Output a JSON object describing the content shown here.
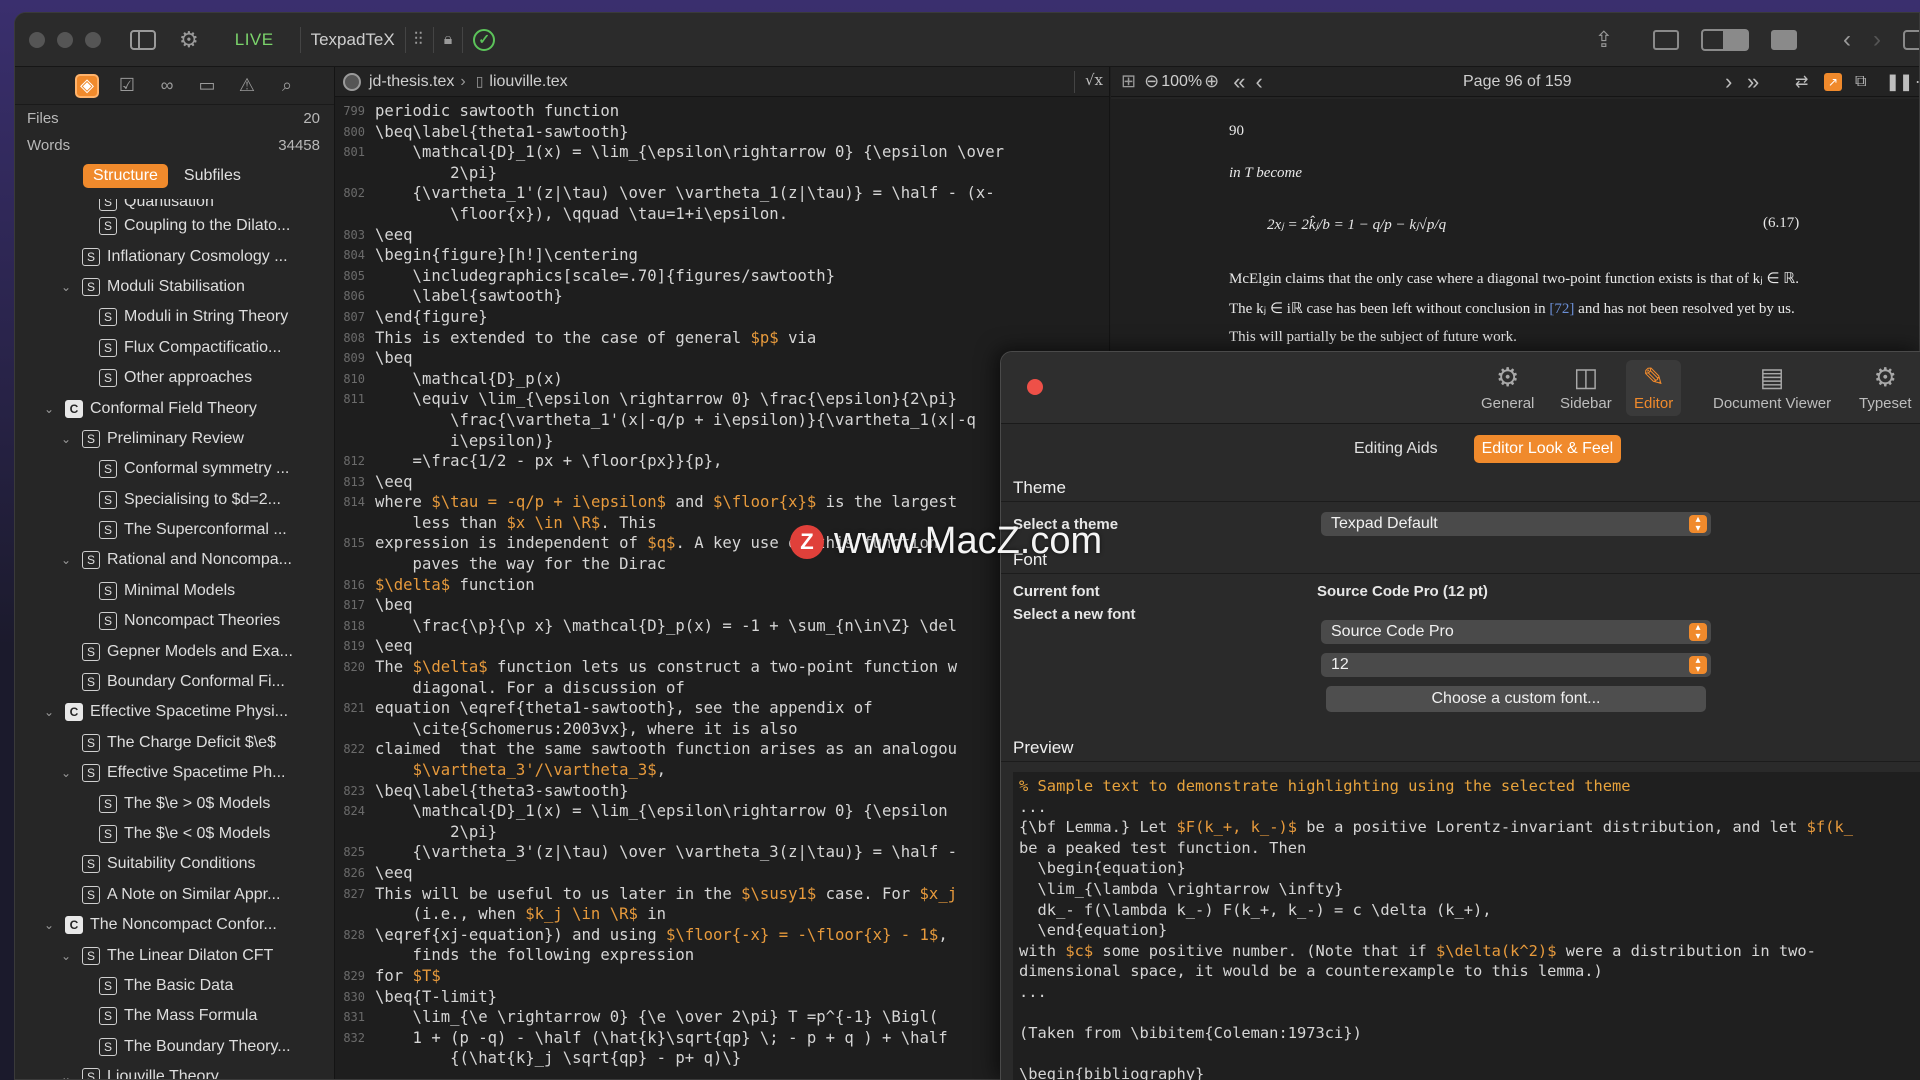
{
  "titlebar": {
    "live_label": "LIVE",
    "app_name": "TexpadTeX"
  },
  "sidebar": {
    "stats": [
      {
        "label": "Files",
        "value": "20"
      },
      {
        "label": "Words",
        "value": "34458"
      }
    ],
    "tabs": [
      "Structure",
      "Subfiles"
    ],
    "tree": [
      {
        "indent": 3,
        "badge": "S",
        "chev": "",
        "label": "Quantisation"
      },
      {
        "indent": 3,
        "badge": "S",
        "chev": "",
        "label": "Coupling to the Dilato..."
      },
      {
        "indent": 2,
        "badge": "S",
        "chev": "",
        "label": "Inflationary Cosmology ..."
      },
      {
        "indent": 2,
        "badge": "S",
        "chev": "⌄",
        "label": "Moduli Stabilisation"
      },
      {
        "indent": 3,
        "badge": "S",
        "chev": "",
        "label": "Moduli in String Theory"
      },
      {
        "indent": 3,
        "badge": "S",
        "chev": "",
        "label": "Flux Compactificatio..."
      },
      {
        "indent": 3,
        "badge": "S",
        "chev": "",
        "label": "Other approaches"
      },
      {
        "indent": 1,
        "badge": "C",
        "chev": "⌄",
        "label": "Conformal Field Theory"
      },
      {
        "indent": 2,
        "badge": "S",
        "chev": "⌄",
        "label": "Preliminary Review"
      },
      {
        "indent": 3,
        "badge": "S",
        "chev": "",
        "label": "Conformal symmetry ..."
      },
      {
        "indent": 3,
        "badge": "S",
        "chev": "",
        "label": "Specialising to $d=2..."
      },
      {
        "indent": 3,
        "badge": "S",
        "chev": "",
        "label": "The Superconformal ..."
      },
      {
        "indent": 2,
        "badge": "S",
        "chev": "⌄",
        "label": "Rational and Noncompa..."
      },
      {
        "indent": 3,
        "badge": "S",
        "chev": "",
        "label": "Minimal Models"
      },
      {
        "indent": 3,
        "badge": "S",
        "chev": "",
        "label": "Noncompact Theories"
      },
      {
        "indent": 2,
        "badge": "S",
        "chev": "",
        "label": "Gepner Models and Exa..."
      },
      {
        "indent": 2,
        "badge": "S",
        "chev": "",
        "label": "Boundary Conformal Fi..."
      },
      {
        "indent": 1,
        "badge": "C",
        "chev": "⌄",
        "label": "Effective Spacetime Physi..."
      },
      {
        "indent": 2,
        "badge": "S",
        "chev": "",
        "label": "The Charge Deficit $\\e$"
      },
      {
        "indent": 2,
        "badge": "S",
        "chev": "⌄",
        "label": "Effective Spacetime Ph..."
      },
      {
        "indent": 3,
        "badge": "S",
        "chev": "",
        "label": "The $\\e > 0$ Models"
      },
      {
        "indent": 3,
        "badge": "S",
        "chev": "",
        "label": "The $\\e < 0$ Models"
      },
      {
        "indent": 2,
        "badge": "S",
        "chev": "",
        "label": "Suitability Conditions"
      },
      {
        "indent": 2,
        "badge": "S",
        "chev": "",
        "label": "A Note on Similar Appr..."
      },
      {
        "indent": 1,
        "badge": "C",
        "chev": "⌄",
        "label": "The Noncompact Confor..."
      },
      {
        "indent": 2,
        "badge": "S",
        "chev": "⌄",
        "label": "The Linear Dilaton CFT"
      },
      {
        "indent": 3,
        "badge": "S",
        "chev": "",
        "label": "The Basic Data"
      },
      {
        "indent": 3,
        "badge": "S",
        "chev": "",
        "label": "The Mass Formula"
      },
      {
        "indent": 3,
        "badge": "S",
        "chev": "",
        "label": "The Boundary Theory..."
      },
      {
        "indent": 2,
        "badge": "S",
        "chev": "⌄",
        "label": "Liouville Theory"
      }
    ]
  },
  "editor": {
    "breadcrumb_file": "jd-thesis.tex",
    "breadcrumb_sep": "›",
    "breadcrumb_current": "liouville.tex",
    "sqrt_button": "√x",
    "lines": [
      {
        "n": "799",
        "t": "periodic sawtooth function"
      },
      {
        "n": "800",
        "t": "\\beq\\label{theta1-sawtooth}"
      },
      {
        "n": "801",
        "t": "    \\mathcal{D}_1(x) = \\lim_{\\epsilon\\rightarrow 0} {\\epsilon \\over"
      },
      {
        "n": "",
        "t": "        2\\pi}"
      },
      {
        "n": "802",
        "t": "    {\\vartheta_1'(z|\\tau) \\over \\vartheta_1(z|\\tau)} = \\half - (x-"
      },
      {
        "n": "",
        "t": "        \\floor{x}), \\qquad \\tau=1+i\\epsilon."
      },
      {
        "n": "803",
        "t": "\\eeq"
      },
      {
        "n": "804",
        "t": "\\begin{figure}[h!]\\centering"
      },
      {
        "n": "805",
        "t": "    \\includegraphics[scale=.70]{figures/sawtooth}"
      },
      {
        "n": "806",
        "t": "    \\label{sawtooth}"
      },
      {
        "n": "807",
        "t": "\\end{figure}"
      },
      {
        "n": "808",
        "t": "This is extended to the case of general $p$ via"
      },
      {
        "n": "809",
        "t": "\\beq"
      },
      {
        "n": "810",
        "t": "    \\mathcal{D}_p(x)"
      },
      {
        "n": "811",
        "t": "    \\equiv \\lim_{\\epsilon \\rightarrow 0} \\frac{\\epsilon}{2\\pi}"
      },
      {
        "n": "",
        "t": "        \\frac{\\vartheta_1'(x|-q/p + i\\epsilon)}{\\vartheta_1(x|-q"
      },
      {
        "n": "",
        "t": "        i\\epsilon)}"
      },
      {
        "n": "812",
        "t": "    =\\frac{1/2 - px + \\floor{px}}{p},"
      },
      {
        "n": "813",
        "t": "\\eeq"
      },
      {
        "n": "814",
        "t": "where $\\tau = -q/p + i\\epsilon$ and $\\floor{x}$ is the largest"
      },
      {
        "n": "",
        "t": "    less than $x \\in \\R$. This"
      },
      {
        "n": "815",
        "t": "expression is independent of $q$. A key use of this function"
      },
      {
        "n": "",
        "t": "    paves the way for the Dirac"
      },
      {
        "n": "816",
        "t": "$\\delta$ function"
      },
      {
        "n": "817",
        "t": "\\beq"
      },
      {
        "n": "818",
        "t": "    \\frac{\\p}{\\p x} \\mathcal{D}_p(x) = -1 + \\sum_{n\\in\\Z} \\del"
      },
      {
        "n": "819",
        "t": "\\eeq"
      },
      {
        "n": "820",
        "t": "The $\\delta$ function lets us construct a two-point function w"
      },
      {
        "n": "",
        "t": "    diagonal. For a discussion of"
      },
      {
        "n": "821",
        "t": "equation \\eqref{theta1-sawtooth}, see the appendix of"
      },
      {
        "n": "",
        "t": "    \\cite{Schomerus:2003vx}, where it is also"
      },
      {
        "n": "822",
        "t": "claimed  that the same sawtooth function arises as an analogou"
      },
      {
        "n": "",
        "t": "    $\\vartheta_3'/\\vartheta_3$,"
      },
      {
        "n": "823",
        "t": "\\beq\\label{theta3-sawtooth}"
      },
      {
        "n": "824",
        "t": "    \\mathcal{D}_1(x) = \\lim_{\\epsilon\\rightarrow 0} {\\epsilon"
      },
      {
        "n": "",
        "t": "        2\\pi}"
      },
      {
        "n": "825",
        "t": "    {\\vartheta_3'(z|\\tau) \\over \\vartheta_3(z|\\tau)} = \\half -"
      },
      {
        "n": "826",
        "t": "\\eeq"
      },
      {
        "n": "827",
        "t": "This will be useful to us later in the $\\susy1$ case. For $x_j"
      },
      {
        "n": "",
        "t": "    (i.e., when $k_j \\in \\R$ in"
      },
      {
        "n": "828",
        "t": "\\eqref{xj-equation}) and using $\\floor{-x} = -\\floor{x} - 1$,"
      },
      {
        "n": "",
        "t": "    finds the following expression"
      },
      {
        "n": "829",
        "t": "for $T$"
      },
      {
        "n": "830",
        "t": "\\beq{T-limit}"
      },
      {
        "n": "831",
        "t": "    \\lim_{\\e \\rightarrow 0} {\\e \\over 2\\pi} T =p^{-1} \\Bigl("
      },
      {
        "n": "832",
        "t": "    1 + (p -q) - \\half (\\hat{k}\\sqrt{qp} \\; - p + q ) + \\half"
      },
      {
        "n": "",
        "t": "        {(\\hat{k}_j \\sqrt{qp} - p+ q)\\}"
      }
    ]
  },
  "viewer": {
    "zoom": "100%",
    "page_label": "Page 96 of 159",
    "page_number": "90",
    "text1": "in T become",
    "equation": "2xⱼ = 2k̂ⱼ/b = 1 − q/p − kⱼ√p/q",
    "eq_number": "(6.17)",
    "para1": "McElgin claims that the only case where a diagonal two-point function exists is that of kⱼ ∈ ℝ.",
    "para2a": "The kⱼ ∈ iℝ case has been left without conclusion in ",
    "para2ref": "[72]",
    "para2b": " and has not been resolved yet by us.",
    "para3": "This will partially be the subject of future work."
  },
  "prefs": {
    "tabs": [
      {
        "label": "General",
        "icon": "gear-icon"
      },
      {
        "label": "Sidebar",
        "icon": "sidebar-icon"
      },
      {
        "label": "Editor",
        "icon": "pencil-icon"
      },
      {
        "label": "Document Viewer",
        "icon": "document-icon"
      },
      {
        "label": "Typeset",
        "icon": "gears-icon"
      }
    ],
    "subtabs": [
      "Editing Aids",
      "Editor Look & Feel"
    ],
    "theme_section": "Theme",
    "theme_label": "Select a theme",
    "theme_value": "Texpad Default",
    "font_section": "Font",
    "current_font_label": "Current font",
    "current_font_value": "Source Code Pro (12 pt)",
    "new_font_label": "Select a new font",
    "font_value": "Source Code Pro",
    "size_value": "12",
    "custom_font_button": "Choose a custom font...",
    "preview_section": "Preview",
    "preview_lines": [
      "% Sample text to demonstrate highlighting using the selected theme",
      "...",
      "{\\bf Lemma.} Let $F(k_+, k_-)$ be a positive Lorentz-invariant distribution, and let $f(k_",
      "be a peaked test function. Then",
      "  \\begin{equation}",
      "  \\lim_{\\lambda \\rightarrow \\infty}",
      "  dk_- f(\\lambda k_-) F(k_+, k_-) = c \\delta (k_+),",
      "  \\end{equation}",
      "with $c$ some positive number. (Note that if $\\delta(k^2)$ were a distribution in two-",
      "dimensional space, it would be a counterexample to this lemma.)",
      "...",
      "",
      "(Taken from \\bibitem{Coleman:1973ci})",
      "",
      "\\begin{bibliography}"
    ]
  },
  "watermark": {
    "letter": "Z",
    "text": "www.MacZ.com"
  },
  "colors": {
    "accent": "#f08a2c",
    "live": "#7bd36b",
    "close": "#ee5048"
  }
}
